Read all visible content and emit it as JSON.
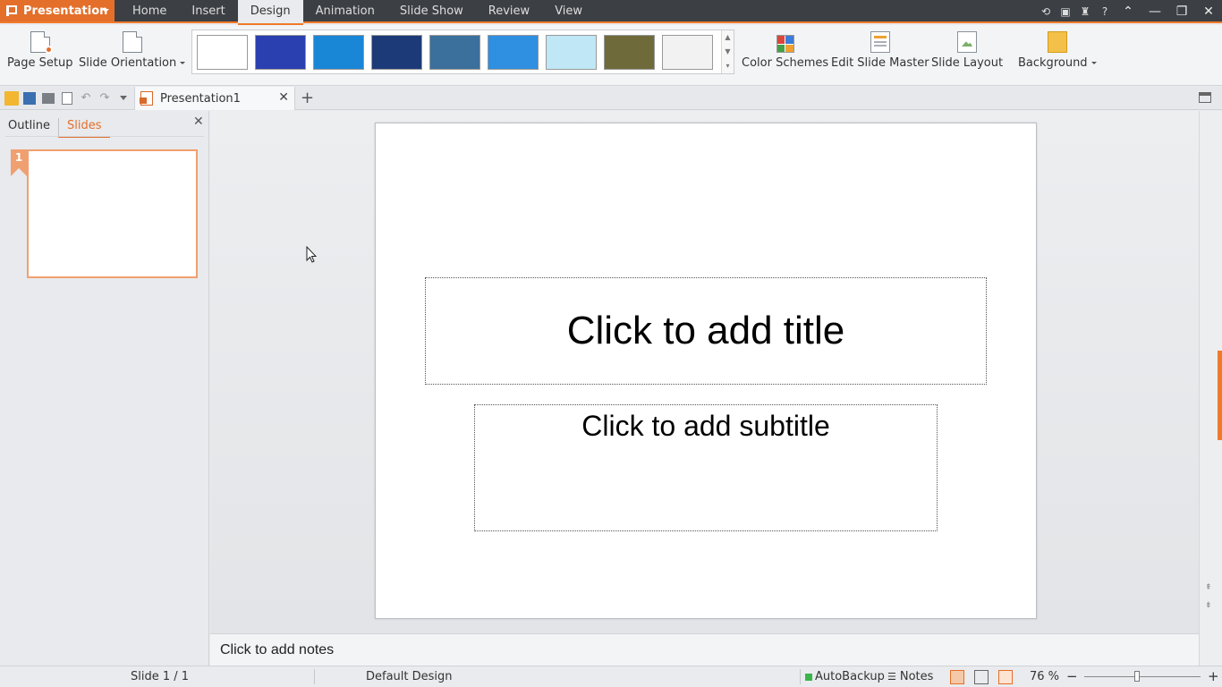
{
  "menubar": {
    "app_name": "Presentation",
    "tabs": [
      "Home",
      "Insert",
      "Design",
      "Animation",
      "Slide Show",
      "Review",
      "View"
    ],
    "active_tab": "Design",
    "help_label": "?"
  },
  "ribbon": {
    "page_setup": "Page Setup",
    "slide_orientation": "Slide Orientation",
    "color_schemes": "Color Schemes",
    "edit_slide_master": "Edit Slide Master",
    "slide_layout": "Slide Layout",
    "background": "Background",
    "design_thumbnails": [
      {
        "bg": "#ffffff"
      },
      {
        "bg": "#2a3fb0"
      },
      {
        "bg": "#1a86d6"
      },
      {
        "bg": "#1d3a78"
      },
      {
        "bg": "#3b6f9c"
      },
      {
        "bg": "#2f8fe0"
      },
      {
        "bg": "#bfe7f5"
      },
      {
        "bg": "#6f6a3a"
      },
      {
        "bg": "#f2f2f2"
      }
    ]
  },
  "document_tab": {
    "title": "Presentation1",
    "close": "✕",
    "new_tab": "+"
  },
  "left_pane": {
    "tabs": [
      "Outline",
      "Slides"
    ],
    "active_tab": "Slides",
    "close": "✕",
    "slides": [
      {
        "number": "1"
      }
    ]
  },
  "slide": {
    "title_placeholder": "Click to add title",
    "subtitle_placeholder": "Click to add subtitle"
  },
  "notes": {
    "placeholder": "Click to add notes"
  },
  "statusbar": {
    "slide_info": "Slide 1 / 1",
    "design_name": "Default Design",
    "autobackup": "AutoBackup",
    "notes": "Notes",
    "zoom": "76 %",
    "zoom_out": "−",
    "zoom_in": "+",
    "zoom_level": 0.45
  },
  "colors": {
    "accent": "#e46f2a",
    "menubar_bg": "#3c3f44",
    "autobackup_status": "#3bb54a"
  }
}
